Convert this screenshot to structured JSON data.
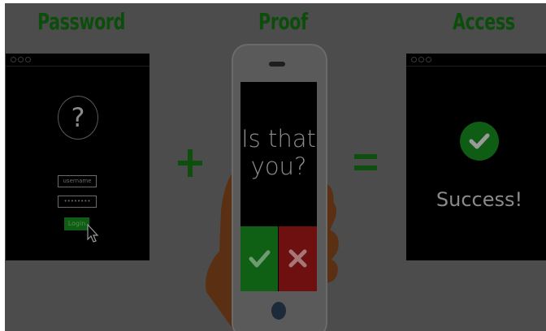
{
  "headings": {
    "password": "Password",
    "proof": "Proof",
    "access": "Access"
  },
  "login_window": {
    "question_mark": "?",
    "username_placeholder": "username",
    "password_value": "••••••••",
    "login_label": "Login"
  },
  "phone": {
    "prompt_line1": "Is that",
    "prompt_line2": "you?",
    "yes_icon": "check-icon",
    "no_icon": "x-icon"
  },
  "operators": {
    "plus": "+",
    "equals": "="
  },
  "access_window": {
    "status_text": "Success!"
  },
  "colors": {
    "backdrop": "#4c4c4c",
    "heading_green": "#0c4d0c",
    "accept_green": "#0f5f14",
    "reject_red": "#6e1010",
    "screen_black": "#000000"
  }
}
